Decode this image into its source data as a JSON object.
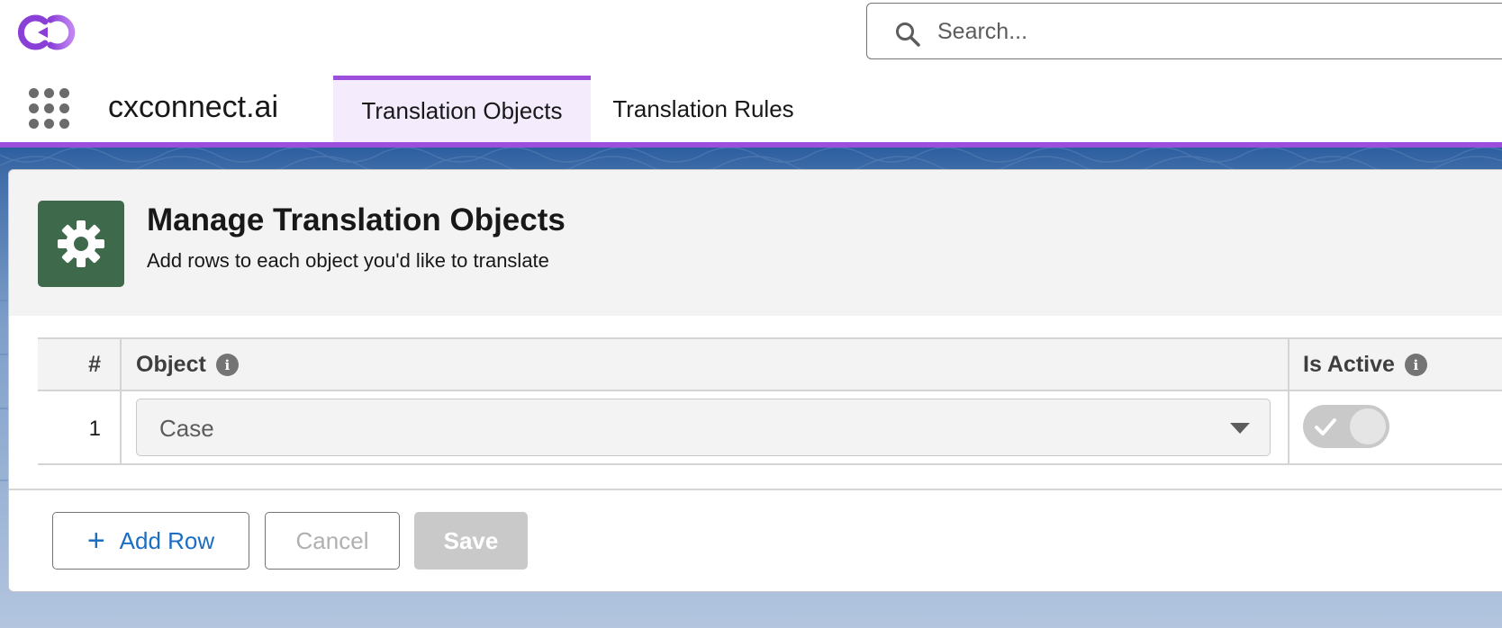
{
  "header": {
    "logo_icon": "cxconnect-logo",
    "search": {
      "placeholder": "Search...",
      "icon": "search-icon"
    }
  },
  "nav": {
    "app_launcher_icon": "app-launcher-grid-icon",
    "app_name": "cxconnect.ai",
    "tabs": [
      {
        "label": "Translation Objects",
        "active": true
      },
      {
        "label": "Translation Rules",
        "active": false
      }
    ],
    "accent_color": "#9b4fdc"
  },
  "card": {
    "icon": "gear-icon",
    "icon_bg": "#3e6a4b",
    "title": "Manage Translation Objects",
    "subtitle": "Add rows to each object you'd like to translate"
  },
  "table": {
    "columns": [
      {
        "label": "#"
      },
      {
        "label": "Object",
        "info_icon": true
      },
      {
        "label": "Is Active",
        "info_icon": true
      }
    ],
    "rows": [
      {
        "num": "1",
        "object": "Case",
        "is_active": true
      }
    ]
  },
  "actions": {
    "add_row_label": "Add Row",
    "cancel_label": "Cancel",
    "save_label": "Save"
  }
}
